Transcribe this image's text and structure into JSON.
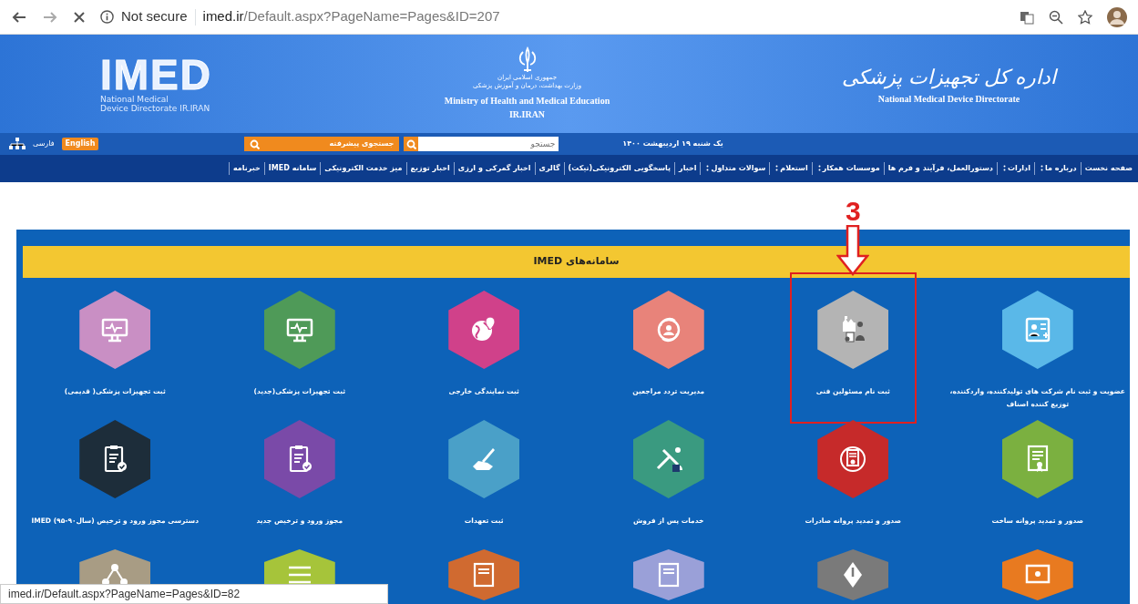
{
  "browser": {
    "loading": true,
    "security": "Not secure",
    "url_host": "imed.ir",
    "url_path": "/Default.aspx?PageName=Pages&ID=207"
  },
  "header": {
    "logo_text": "IMED",
    "logo_subtitle": [
      "National Medical",
      "Device Directorate IR.IRAN"
    ],
    "emblem_lines": [
      "جمهوری اسلامی ایران",
      "وزارت بهداشت، درمان و آموزش پزشکی"
    ],
    "ministry": "Ministry of Health and Medical Education",
    "country": "IR.IRAN",
    "title_fa": "اداره کل تجهیزات پزشکی",
    "title_en": "National Medical Device Directorate"
  },
  "toolbar": {
    "language_current": "فارسی",
    "language_switch": "English",
    "advanced_search": "جستجوی پیشرفته",
    "search": {
      "placeholder": "جستجو"
    },
    "date": "یک شنبه ۱۹ اردیبهشت ۱۴۰۰"
  },
  "nav": [
    {
      "label": "صفحه نخست",
      "dropdown": false
    },
    {
      "label": "درباره ما",
      "dropdown": true
    },
    {
      "label": "ادارات",
      "dropdown": true
    },
    {
      "label": "دستورالعمل، فرآیند و فرم ها",
      "dropdown": false
    },
    {
      "label": "موسسات همکار",
      "dropdown": true
    },
    {
      "label": "استعلام",
      "dropdown": true
    },
    {
      "label": "سوالات متداول",
      "dropdown": true
    },
    {
      "label": "اخبار",
      "dropdown": false
    },
    {
      "label": "پاسخگویی الکترونیکی(تیکت)",
      "dropdown": false
    },
    {
      "label": "گالری",
      "dropdown": false
    },
    {
      "label": "اخبار گمرکی و ارزی",
      "dropdown": false
    },
    {
      "label": "اخبار توزیع",
      "dropdown": false
    },
    {
      "label": "میز خدمت الکترونیکی",
      "dropdown": false
    },
    {
      "label": "سامانه IMED",
      "dropdown": false
    },
    {
      "label": "خبرنامه",
      "dropdown": false
    }
  ],
  "panel": {
    "title": "سامانه‌های IMED",
    "tiles": [
      {
        "label": "عضویت و ثبت نام شرکت های تولیدکننده، واردکننده، توزیع کننده اصناف",
        "color": "#5ab8e8",
        "highlighted": false
      },
      {
        "label": "ثبت نام مسئولین فنی",
        "color": "#b4b4b4",
        "highlighted": true,
        "annotation": "3"
      },
      {
        "label": "مدیریت تردد مراجعین",
        "color": "#e8837a",
        "highlighted": false
      },
      {
        "label": "ثبت نمایندگی خارجی",
        "color": "#d0418a",
        "highlighted": false
      },
      {
        "label": "ثبت تجهیزات پزشکی(جدید)",
        "color": "#4f9a58",
        "highlighted": false
      },
      {
        "label": "ثبت تجهیزات پزشکی( قدیمی)",
        "color": "#c98fc4",
        "highlighted": false
      },
      {
        "label": "صدور و تمدید پروانه ساخت",
        "color": "#7bb040",
        "highlighted": false
      },
      {
        "label": "صدور و تمدید پروانه صادرات",
        "color": "#c62a2a",
        "highlighted": false
      },
      {
        "label": "خدمات پس از فروش",
        "color": "#3a9a80",
        "highlighted": false
      },
      {
        "label": "ثبت تعهدات",
        "color": "#4aa0c8",
        "highlighted": false
      },
      {
        "label": "مجوز ورود و ترخیص جدید",
        "color": "#7a4aa8",
        "highlighted": false
      },
      {
        "label": "دسترسی مجوز ورود و ترخیص (سال۹۰-۹۵) IMED",
        "color": "#1d2d3a",
        "highlighted": false
      },
      {
        "color": "#e87a20",
        "highlighted": false
      },
      {
        "color": "#7a7a7a",
        "highlighted": false
      },
      {
        "color": "#9aa0d8",
        "highlighted": false
      },
      {
        "color": "#d06a30",
        "highlighted": false
      },
      {
        "color": "#a6c43a",
        "highlighted": false
      },
      {
        "color": "#a89c84",
        "highlighted": false
      }
    ]
  },
  "status_url": "imed.ir/Default.aspx?PageName=Pages&ID=82"
}
